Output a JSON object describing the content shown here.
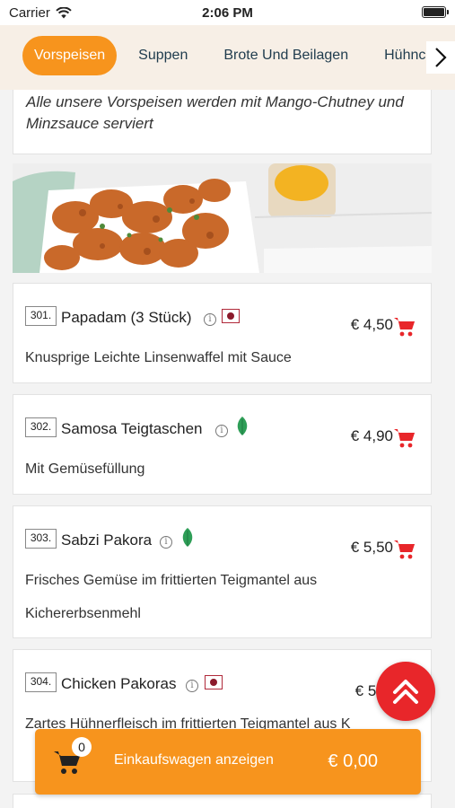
{
  "status_bar": {
    "carrier": "Carrier",
    "time": "2:06 PM"
  },
  "tabs": [
    {
      "label": "Vorspeisen",
      "active": true
    },
    {
      "label": "Suppen",
      "active": false
    },
    {
      "label": "Brote Und Beilagen",
      "active": false
    },
    {
      "label": "Hühnchen",
      "active": false
    }
  ],
  "category_notice": "Alle unsere Vorspeisen werden mit Mango-Chutney und Minzsauce serviert",
  "items": [
    {
      "number": "301.",
      "name": "Papadam (3 Stück)",
      "badge": "non-veg",
      "price": "€ 4,50",
      "description": "Knusprige Leichte Linsenwaffel mit Sauce"
    },
    {
      "number": "302.",
      "name": "Samosa Teigtaschen",
      "badge": "vegetarian-leaf",
      "price": "€ 4,90",
      "description": "Mit Gemüsefüllung"
    },
    {
      "number": "303.",
      "name": "Sabzi Pakora",
      "badge": "vegetarian-leaf",
      "price": "€ 5,50",
      "description": "Frisches Gemüse im frittierten Teigmantel aus Kichererbsenmehl"
    },
    {
      "number": "304.",
      "name": "Chicken Pakoras",
      "badge": "non-veg",
      "price": "€ 5,",
      "description": "Zartes Hühnerfleisch im frittierten Teigmantel aus K"
    }
  ],
  "cart_bar": {
    "count": "0",
    "label": "Einkaufswagen anzeigen",
    "total": "€ 0,00"
  },
  "icons": {
    "info": "info-icon",
    "cart": "cart-icon",
    "scroll_top": "double-chevron-up-icon"
  },
  "colors": {
    "accent": "#f7941d",
    "tab_bg": "#f7efe6",
    "cart_red": "#e8262a",
    "leaf_green": "#2e9e57",
    "meat_red": "#8b1a2b"
  }
}
